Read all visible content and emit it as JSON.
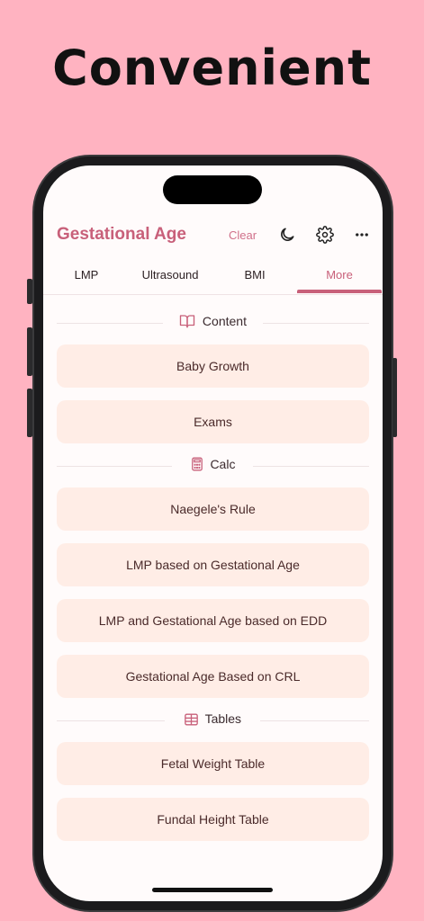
{
  "promo": {
    "headline": "Convenient"
  },
  "app": {
    "title": "Gestational Age",
    "clear_label": "Clear"
  },
  "icons": {
    "theme": "moon-icon",
    "settings": "gear-icon",
    "more": "ellipsis-icon"
  },
  "tabs": [
    {
      "label": "LMP"
    },
    {
      "label": "Ultrasound"
    },
    {
      "label": "BMI"
    },
    {
      "label": "More",
      "active": true
    }
  ],
  "sections": {
    "content": {
      "title": "Content",
      "icon": "book-icon",
      "items": [
        "Baby Growth",
        "Exams"
      ]
    },
    "calc": {
      "title": "Calc",
      "icon": "calculator-icon",
      "items": [
        "Naegele's Rule",
        "LMP based on Gestational Age",
        "LMP and Gestational Age based on EDD",
        "Gestational Age Based on CRL"
      ]
    },
    "tables": {
      "title": "Tables",
      "icon": "table-icon",
      "items": [
        "Fetal Weight Table",
        "Fundal Height Table"
      ]
    }
  },
  "colors": {
    "background": "#FFB3C1",
    "accent": "#C8607A",
    "item_bg": "#FFEDE6"
  }
}
